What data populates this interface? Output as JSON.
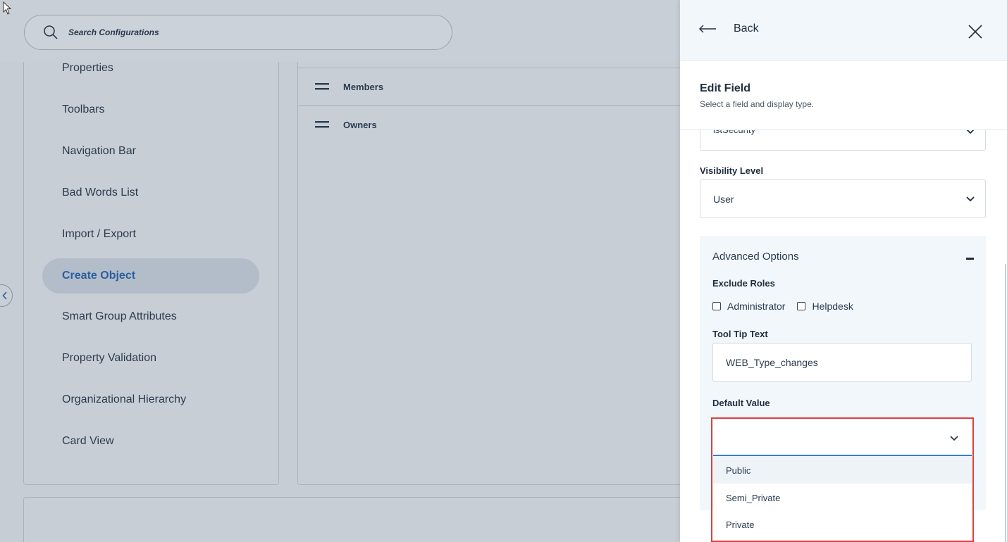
{
  "search": {
    "placeholder": "Search Configurations"
  },
  "sidebar": {
    "items": [
      {
        "label": "Properties"
      },
      {
        "label": "Toolbars"
      },
      {
        "label": "Navigation Bar"
      },
      {
        "label": "Bad Words List"
      },
      {
        "label": "Import / Export"
      },
      {
        "label": "Create Object",
        "active": true
      },
      {
        "label": "Smart Group Attributes"
      },
      {
        "label": "Property Validation"
      },
      {
        "label": "Organizational Hierarchy"
      },
      {
        "label": "Card View"
      }
    ]
  },
  "middle": {
    "rows": [
      {
        "label": "Members"
      },
      {
        "label": "Owners"
      }
    ]
  },
  "drawer": {
    "back_label": "Back",
    "title": "Edit Field",
    "subtitle": "Select a field and display type.",
    "field_select_value": "lstSecurity",
    "visibility_label": "Visibility Level",
    "visibility_value": "User",
    "advanced": {
      "title": "Advanced Options",
      "exclude_roles_label": "Exclude Roles",
      "roles": [
        {
          "label": "Administrator",
          "checked": false
        },
        {
          "label": "Helpdesk",
          "checked": false
        }
      ],
      "tooltip_label": "Tool Tip Text",
      "tooltip_value": "WEB_Type_changes",
      "default_value_label": "Default Value",
      "default_value": "",
      "options": [
        {
          "label": "Public"
        },
        {
          "label": "Semi_Private"
        },
        {
          "label": "Private"
        }
      ]
    }
  },
  "colors": {
    "accent": "#2f7fd1",
    "highlight_border": "#e04040",
    "active_nav_text": "#2c5f9e",
    "drawer_header_bg": "#f1f7fb"
  }
}
